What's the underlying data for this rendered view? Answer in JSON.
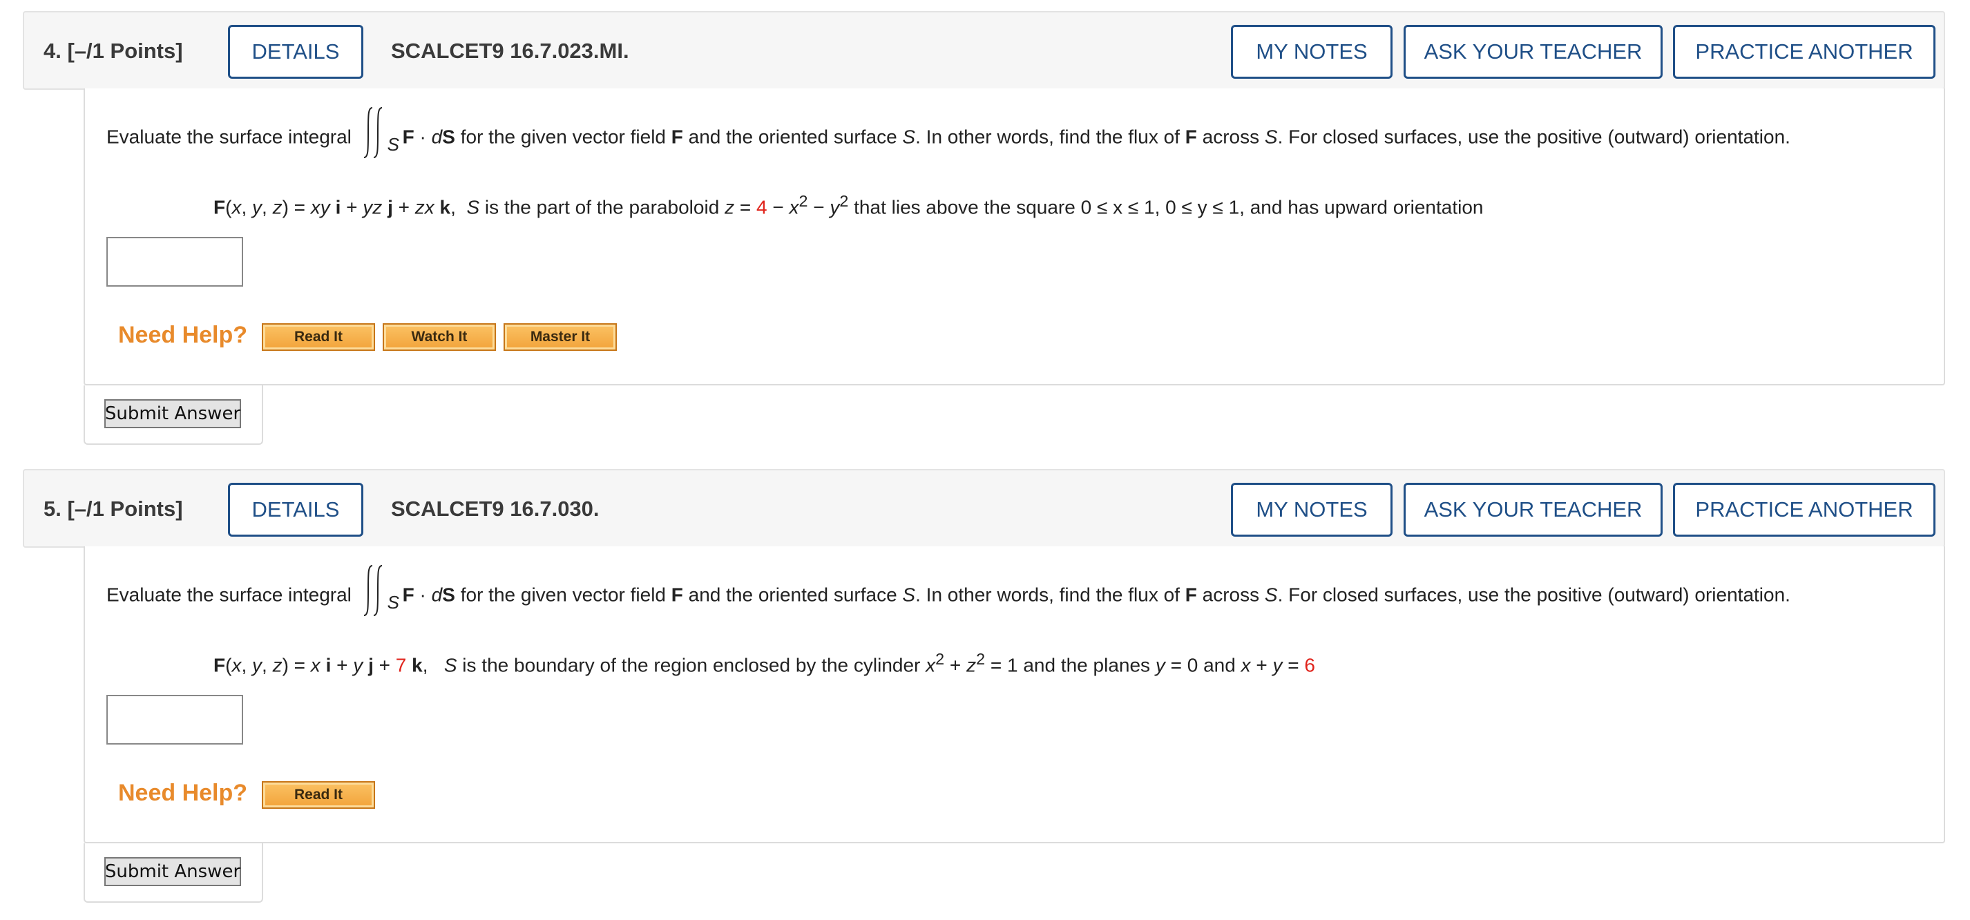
{
  "questions": [
    {
      "number": "4.",
      "points": "[–/1 Points]",
      "details_label": "DETAILS",
      "code": "SCALCET9 16.7.023.MI.",
      "my_notes_label": "MY NOTES",
      "ask_teacher_label": "ASK YOUR TEACHER",
      "practice_label": "PRACTICE ANOTHER",
      "prompt_before": "Evaluate the surface integral",
      "integral_subscript": "S",
      "prompt_after": " for the given vector field ",
      "prompt_rest": " and the oriented surface ",
      "prompt_rest2": ". In other words, find the flux of ",
      "prompt_rest3": " across ",
      "prompt_rest4": ". For closed surfaces, use the positive (outward) orientation.",
      "formula": {
        "constant": "4",
        "tail": " that lies above the square 0 ≤ x ≤ 1, 0 ≤ y ≤ 1, and has upward orientation"
      },
      "need_help_label": "Need Help?",
      "help_buttons": [
        "Read It",
        "Watch It",
        "Master It"
      ],
      "submit_label": "Submit Answer"
    },
    {
      "number": "5.",
      "points": "[–/1 Points]",
      "details_label": "DETAILS",
      "code": "SCALCET9 16.7.030.",
      "my_notes_label": "MY NOTES",
      "ask_teacher_label": "ASK YOUR TEACHER",
      "practice_label": "PRACTICE ANOTHER",
      "prompt_before": "Evaluate the surface integral",
      "integral_subscript": "S",
      "prompt_after": " for the given vector field ",
      "prompt_rest": " and the oriented surface ",
      "prompt_rest2": ". In other words, find the flux of ",
      "prompt_rest3": " across ",
      "prompt_rest4": ". For closed surfaces, use the positive (outward) orientation.",
      "formula": {
        "constant_k": "7",
        "constant_plane": "6"
      },
      "need_help_label": "Need Help?",
      "help_buttons": [
        "Read It"
      ],
      "submit_label": "Submit Answer"
    }
  ],
  "colors": {
    "accent_blue": "#1f4f87",
    "help_orange": "#e88a2b",
    "highlight_red": "#e0241c"
  }
}
